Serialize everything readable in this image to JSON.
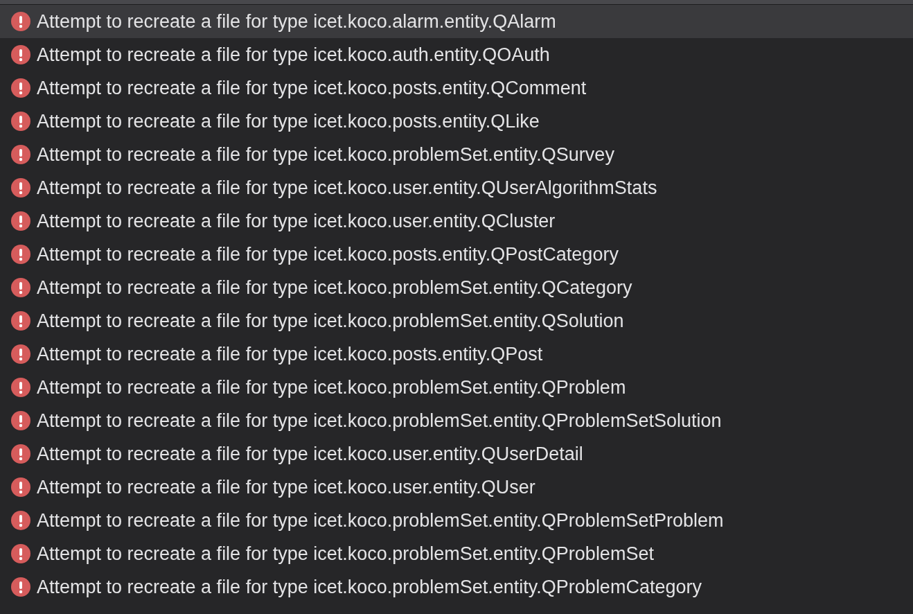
{
  "errors": [
    {
      "message": "Attempt to recreate a file for type icet.koco.alarm.entity.QAlarm",
      "selected": true
    },
    {
      "message": "Attempt to recreate a file for type icet.koco.auth.entity.QOAuth",
      "selected": false
    },
    {
      "message": "Attempt to recreate a file for type icet.koco.posts.entity.QComment",
      "selected": false
    },
    {
      "message": "Attempt to recreate a file for type icet.koco.posts.entity.QLike",
      "selected": false
    },
    {
      "message": "Attempt to recreate a file for type icet.koco.problemSet.entity.QSurvey",
      "selected": false
    },
    {
      "message": "Attempt to recreate a file for type icet.koco.user.entity.QUserAlgorithmStats",
      "selected": false
    },
    {
      "message": "Attempt to recreate a file for type icet.koco.user.entity.QCluster",
      "selected": false
    },
    {
      "message": "Attempt to recreate a file for type icet.koco.posts.entity.QPostCategory",
      "selected": false
    },
    {
      "message": "Attempt to recreate a file for type icet.koco.problemSet.entity.QCategory",
      "selected": false
    },
    {
      "message": "Attempt to recreate a file for type icet.koco.problemSet.entity.QSolution",
      "selected": false
    },
    {
      "message": "Attempt to recreate a file for type icet.koco.posts.entity.QPost",
      "selected": false
    },
    {
      "message": "Attempt to recreate a file for type icet.koco.problemSet.entity.QProblem",
      "selected": false
    },
    {
      "message": "Attempt to recreate a file for type icet.koco.problemSet.entity.QProblemSetSolution",
      "selected": false
    },
    {
      "message": "Attempt to recreate a file for type icet.koco.user.entity.QUserDetail",
      "selected": false
    },
    {
      "message": "Attempt to recreate a file for type icet.koco.user.entity.QUser",
      "selected": false
    },
    {
      "message": "Attempt to recreate a file for type icet.koco.problemSet.entity.QProblemSetProblem",
      "selected": false
    },
    {
      "message": "Attempt to recreate a file for type icet.koco.problemSet.entity.QProblemSet",
      "selected": false
    },
    {
      "message": "Attempt to recreate a file for type icet.koco.problemSet.entity.QProblemCategory",
      "selected": false
    }
  ]
}
